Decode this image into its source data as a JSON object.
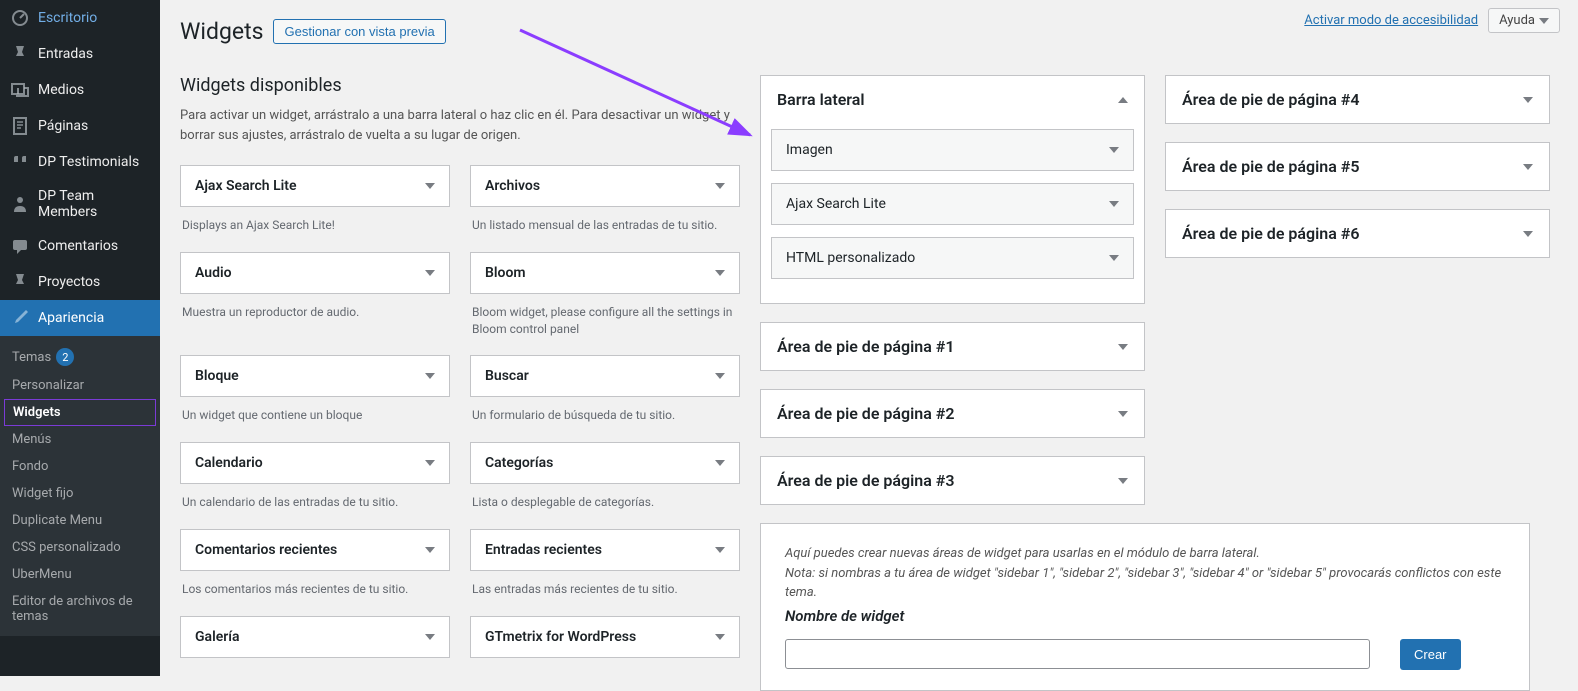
{
  "topbar": {
    "accessibility": "Activar modo de accesibilidad",
    "help": "Ayuda"
  },
  "sidebar": {
    "items": [
      {
        "label": "Escritorio",
        "icon": "dashboard"
      },
      {
        "label": "Entradas",
        "icon": "pin"
      },
      {
        "label": "Medios",
        "icon": "media"
      },
      {
        "label": "Páginas",
        "icon": "page"
      },
      {
        "label": "DP Testimonials",
        "icon": "quote"
      },
      {
        "label": "DP Team Members",
        "icon": "person"
      },
      {
        "label": "Comentarios",
        "icon": "comment"
      },
      {
        "label": "Proyectos",
        "icon": "pin"
      },
      {
        "label": "Apariencia",
        "icon": "brush",
        "active": true
      }
    ],
    "submenu": [
      {
        "label": "Temas",
        "badge": "2"
      },
      {
        "label": "Personalizar"
      },
      {
        "label": "Widgets",
        "current": true
      },
      {
        "label": "Menús"
      },
      {
        "label": "Fondo"
      },
      {
        "label": "Widget fijo"
      },
      {
        "label": "Duplicate Menu"
      },
      {
        "label": "CSS personalizado"
      },
      {
        "label": "UberMenu"
      },
      {
        "label": "Editor de archivos de temas"
      }
    ]
  },
  "page": {
    "title": "Widgets",
    "preview_btn": "Gestionar con vista previa",
    "available_title": "Widgets disponibles",
    "available_desc": "Para activar un widget, arrástralo a una barra lateral o haz clic en él. Para desactivar un widget y borrar sus ajustes, arrástralo de vuelta a su lugar de origen."
  },
  "available_widgets": [
    {
      "name": "Ajax Search Lite",
      "desc": "Displays an Ajax Search Lite!"
    },
    {
      "name": "Archivos",
      "desc": "Un listado mensual de las entradas de tu sitio."
    },
    {
      "name": "Audio",
      "desc": "Muestra un reproductor de audio."
    },
    {
      "name": "Bloom",
      "desc": "Bloom widget, please configure all the settings in Bloom control panel"
    },
    {
      "name": "Bloque",
      "desc": "Un widget que contiene un bloque"
    },
    {
      "name": "Buscar",
      "desc": "Un formulario de búsqueda de tu sitio."
    },
    {
      "name": "Calendario",
      "desc": "Un calendario de las entradas de tu sitio."
    },
    {
      "name": "Categorías",
      "desc": "Lista o desplegable de categorías."
    },
    {
      "name": "Comentarios recientes",
      "desc": "Los comentarios más recientes de tu sitio."
    },
    {
      "name": "Entradas recientes",
      "desc": "Las entradas más recientes de tu sitio."
    },
    {
      "name": "Galería",
      "desc": ""
    },
    {
      "name": "GTmetrix for WordPress",
      "desc": ""
    }
  ],
  "areas_mid": [
    {
      "title": "Barra lateral",
      "open": true,
      "widgets": [
        "Imagen",
        "Ajax Search Lite",
        "HTML personalizado"
      ]
    },
    {
      "title": "Área de pie de página #1"
    },
    {
      "title": "Área de pie de página #2"
    },
    {
      "title": "Área de pie de página #3"
    }
  ],
  "areas_right": [
    {
      "title": "Área de pie de página #4"
    },
    {
      "title": "Área de pie de página #5"
    },
    {
      "title": "Área de pie de página #6"
    }
  ],
  "create": {
    "hint1": "Aquí puedes crear nuevas áreas de widget para usarlas en el módulo de barra lateral.",
    "hint2": "Nota: si nombras a tu área de widget \"sidebar 1\", \"sidebar 2\", \"sidebar 3\", \"sidebar 4\" or \"sidebar 5\" provocarás conflictos con este tema.",
    "label": "Nombre de widget",
    "button": "Crear"
  }
}
